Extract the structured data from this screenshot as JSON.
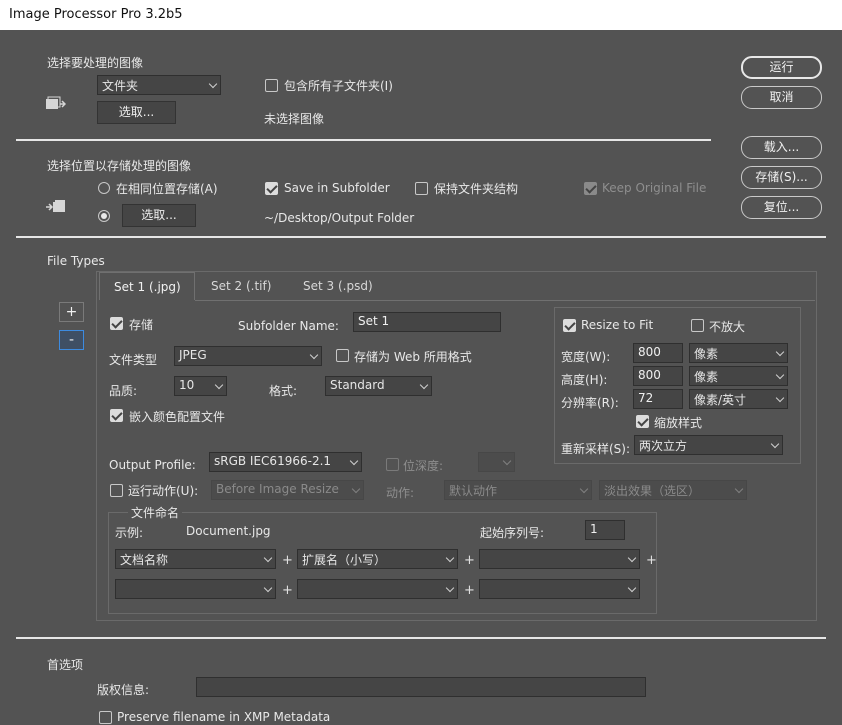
{
  "window": {
    "title": "Image Processor Pro 3.2b5"
  },
  "section1": {
    "title": "选择要处理的图像",
    "source_select": "文件夹",
    "include_subfolders_label": "包含所有子文件夹(I)",
    "include_subfolders_checked": false,
    "select_button": "选取...",
    "status_text": "未选择图像"
  },
  "section2": {
    "title": "选择位置以存储处理的图像",
    "same_location_label": "在相同位置存储(A)",
    "same_location_selected": false,
    "save_in_subfolder_label": "Save in Subfolder",
    "save_in_subfolder_checked": true,
    "keep_folder_structure_label": "保持文件夹结构",
    "keep_folder_structure_checked": false,
    "keep_original_file_label": "Keep Original File",
    "keep_original_file_checked": true,
    "select_button": "选取...",
    "folder_path": "~/Desktop/Output Folder"
  },
  "right_buttons": {
    "run": "运行",
    "cancel": "取消",
    "load": "载入...",
    "save": "存储(S)...",
    "reset": "复位..."
  },
  "file_types": {
    "title": "File Types",
    "add_btn": "+",
    "remove_btn": "-",
    "tabs": [
      "Set 1 (.jpg)",
      "Set 2 (.tif)",
      "Set 3 (.psd)"
    ],
    "active_tab": 0,
    "save_label": "存储",
    "save_checked": true,
    "subfolder_name_label": "Subfolder Name:",
    "subfolder_name_value": "Set 1",
    "file_type_label": "文件类型",
    "file_type_value": "JPEG",
    "save_for_web_label": "存储为 Web 所用格式",
    "save_for_web_checked": false,
    "quality_label": "品质:",
    "quality_value": "10",
    "format_label": "格式:",
    "format_value": "Standard",
    "embed_profile_label": "嵌入颜色配置文件",
    "embed_profile_checked": true,
    "resize": {
      "resize_to_fit_label": "Resize to Fit",
      "resize_to_fit_checked": true,
      "no_enlarge_label": "不放大",
      "no_enlarge_checked": false,
      "width_label": "宽度(W):",
      "width_value": "800",
      "width_unit": "像素",
      "height_label": "高度(H):",
      "height_value": "800",
      "height_unit": "像素",
      "resolution_label": "分辨率(R):",
      "resolution_value": "72",
      "resolution_unit": "像素/英寸",
      "scale_styles_label": "缩放样式",
      "scale_styles_checked": true,
      "resample_label": "重新采样(S):",
      "resample_value": "两次立方"
    },
    "output_profile_label": "Output Profile:",
    "output_profile_value": "sRGB IEC61966-2.1",
    "bit_depth_label": "位深度:",
    "bit_depth_checked": false,
    "run_action_label": "运行动作(U):",
    "run_action_checked": false,
    "action_set_value": "Before Image Resize",
    "action_label": "动作:",
    "action_value": "默认动作",
    "action_name_value": "淡出效果（选区）",
    "naming": {
      "title": "文件命名",
      "example_label": "示例:",
      "example_value": "Document.jpg",
      "start_serial_label": "起始序列号:",
      "start_serial_value": "1",
      "row1": [
        "文档名称",
        "扩展名（小写）",
        ""
      ],
      "row2": [
        "",
        "",
        ""
      ],
      "plus": "+"
    }
  },
  "preferences": {
    "title": "首选项",
    "copyright_label": "版权信息:",
    "copyright_value": "",
    "preserve_filename_label": "Preserve filename in XMP Metadata",
    "preserve_filename_checked": false
  }
}
